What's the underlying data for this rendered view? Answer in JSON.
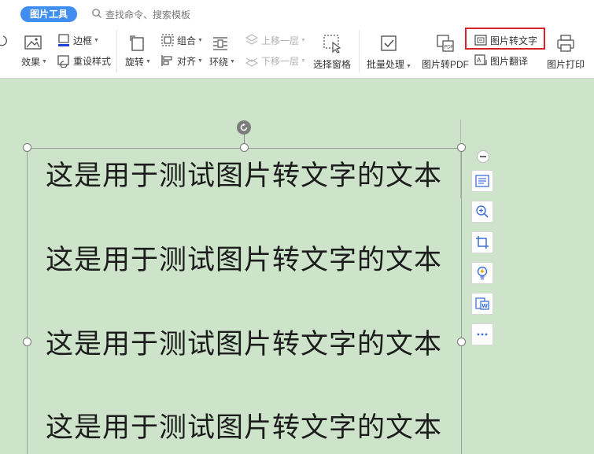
{
  "ribbon": {
    "context_tab": "图片工具",
    "search_placeholder": "查找命令、搜索模板",
    "tools": {
      "effects": "效果",
      "border": "边框",
      "reset_style": "重设样式",
      "rotate": "旋转",
      "group": "组合",
      "align": "对齐",
      "wrap": "环绕",
      "bring_forward": "上移一层",
      "send_backward": "下移一层",
      "selection_pane": "选择窗格",
      "batch_process": "批量处理",
      "to_pdf": "图片转PDF",
      "to_text": "图片转文字",
      "translate": "图片翻译",
      "print": "图片打印"
    },
    "highlight_color": "#d9202b",
    "accent_color": "#3f8ef0"
  },
  "document": {
    "background_color": "#cde4cb",
    "image_lines": [
      "这是用于测试图片转文字的文本",
      "这是用于测试图片转文字的文本",
      "这是用于测试图片转文字的文本",
      "这是用于测试图片转文字的文本"
    ]
  },
  "side_toolbar": [
    "ocr-text-icon",
    "zoom-in-icon",
    "crop-icon",
    "lightbulb-icon",
    "image-to-word-icon",
    "more-icon"
  ]
}
